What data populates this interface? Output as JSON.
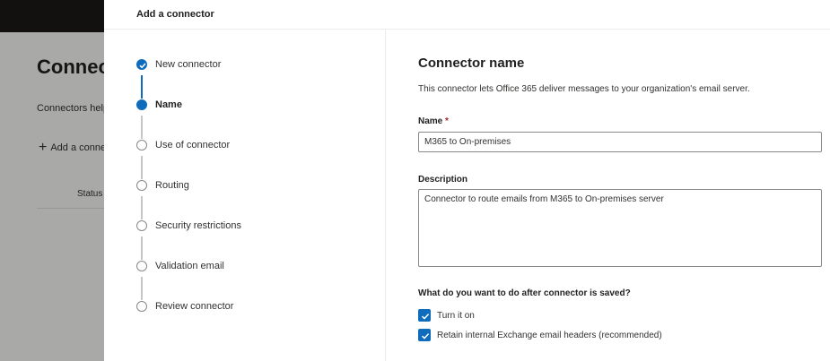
{
  "background": {
    "title": "Connectors",
    "description": "Connectors help",
    "add_label": "Add a connector",
    "column_status": "Status"
  },
  "panel": {
    "title": "Add a connector"
  },
  "steps": [
    {
      "label": "New connector",
      "state": "done"
    },
    {
      "label": "Name",
      "state": "current"
    },
    {
      "label": "Use of connector",
      "state": "pending"
    },
    {
      "label": "Routing",
      "state": "pending"
    },
    {
      "label": "Security restrictions",
      "state": "pending"
    },
    {
      "label": "Validation email",
      "state": "pending"
    },
    {
      "label": "Review connector",
      "state": "pending"
    }
  ],
  "form": {
    "heading": "Connector name",
    "intro": "This connector lets Office 365 deliver messages to your organization's email server.",
    "name_label": "Name",
    "required_mark": "*",
    "name_value": "M365 to On-premises",
    "description_label": "Description",
    "description_value": "Connector to route emails from M365 to On-premises server",
    "after_save_question": "What do you want to do after connector is saved?",
    "options": [
      {
        "label": "Turn it on",
        "checked": true
      },
      {
        "label": "Retain internal Exchange email headers (recommended)",
        "checked": true
      }
    ]
  },
  "colors": {
    "accent": "#0f6cbd",
    "required": "#a4262c"
  }
}
